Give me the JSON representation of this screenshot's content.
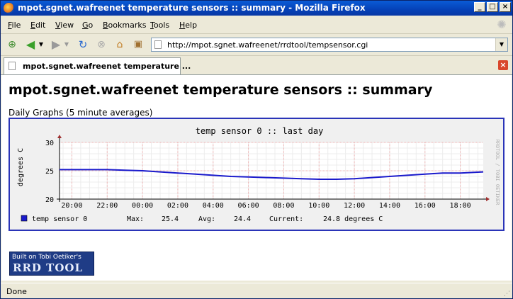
{
  "window": {
    "title": "mpot.sgnet.wafreenet temperature sensors :: summary - Mozilla Firefox",
    "minimize": "_",
    "maximize": "□",
    "close": "×"
  },
  "menu": {
    "items": [
      {
        "accel": "F",
        "rest": "ile"
      },
      {
        "accel": "E",
        "rest": "dit"
      },
      {
        "accel": "V",
        "rest": "iew"
      },
      {
        "accel": "G",
        "rest": "o"
      },
      {
        "accel": "B",
        "rest": "ookmarks"
      },
      {
        "accel": "T",
        "rest": "ools"
      },
      {
        "accel": "H",
        "rest": "elp"
      }
    ]
  },
  "navbar": {
    "url": "http://mpot.sgnet.wafreenet/rrdtool/tempsensor.cgi"
  },
  "tab": {
    "label": "mpot.sgnet.wafreenet temperature ..."
  },
  "page": {
    "title": "mpot.sgnet.wafreenet temperature sensors :: summary",
    "section": "Daily Graphs (5 minute averages)"
  },
  "badge": {
    "line1": "Built on Tobi Oetiker's",
    "line2": "RRD TOOL"
  },
  "status": {
    "text": "Done"
  },
  "colors": {
    "series": "#1a1acc",
    "grid_minor": "#ececec",
    "grid_major": "#f0b0b0",
    "canvas": "#f0f0f0",
    "frame": "#2a34b8"
  },
  "chart_data": {
    "type": "line",
    "title": "temp sensor 0 :: last day",
    "ylabel": "degrees C",
    "watermark": "RRDTOOL / TOBI OETIKER",
    "ylim": [
      20,
      30
    ],
    "yticks": [
      20,
      25,
      30
    ],
    "xticks": [
      "20:00",
      "22:00",
      "00:00",
      "02:00",
      "04:00",
      "06:00",
      "08:00",
      "10:00",
      "12:00",
      "14:00",
      "16:00",
      "18:00"
    ],
    "series": [
      {
        "name": "temp sensor 0",
        "x_hours": [
          19.3,
          20,
          21,
          22,
          23,
          24,
          25,
          26,
          27,
          28,
          29,
          30,
          31,
          32,
          33,
          34,
          35,
          36,
          37,
          38,
          39,
          40,
          41,
          42,
          43.3
        ],
        "values": [
          25.2,
          25.2,
          25.2,
          25.2,
          25.1,
          25.0,
          24.8,
          24.6,
          24.4,
          24.2,
          24.0,
          23.9,
          23.8,
          23.7,
          23.6,
          23.5,
          23.5,
          23.6,
          23.8,
          24.0,
          24.2,
          24.4,
          24.6,
          24.6,
          24.8
        ]
      }
    ],
    "legend": {
      "name": "temp sensor 0",
      "max_label": "Max:",
      "max_value": "25.4",
      "avg_label": "Avg:",
      "avg_value": "24.4",
      "current_label": "Current:",
      "current_value": "24.8 degrees C"
    }
  }
}
